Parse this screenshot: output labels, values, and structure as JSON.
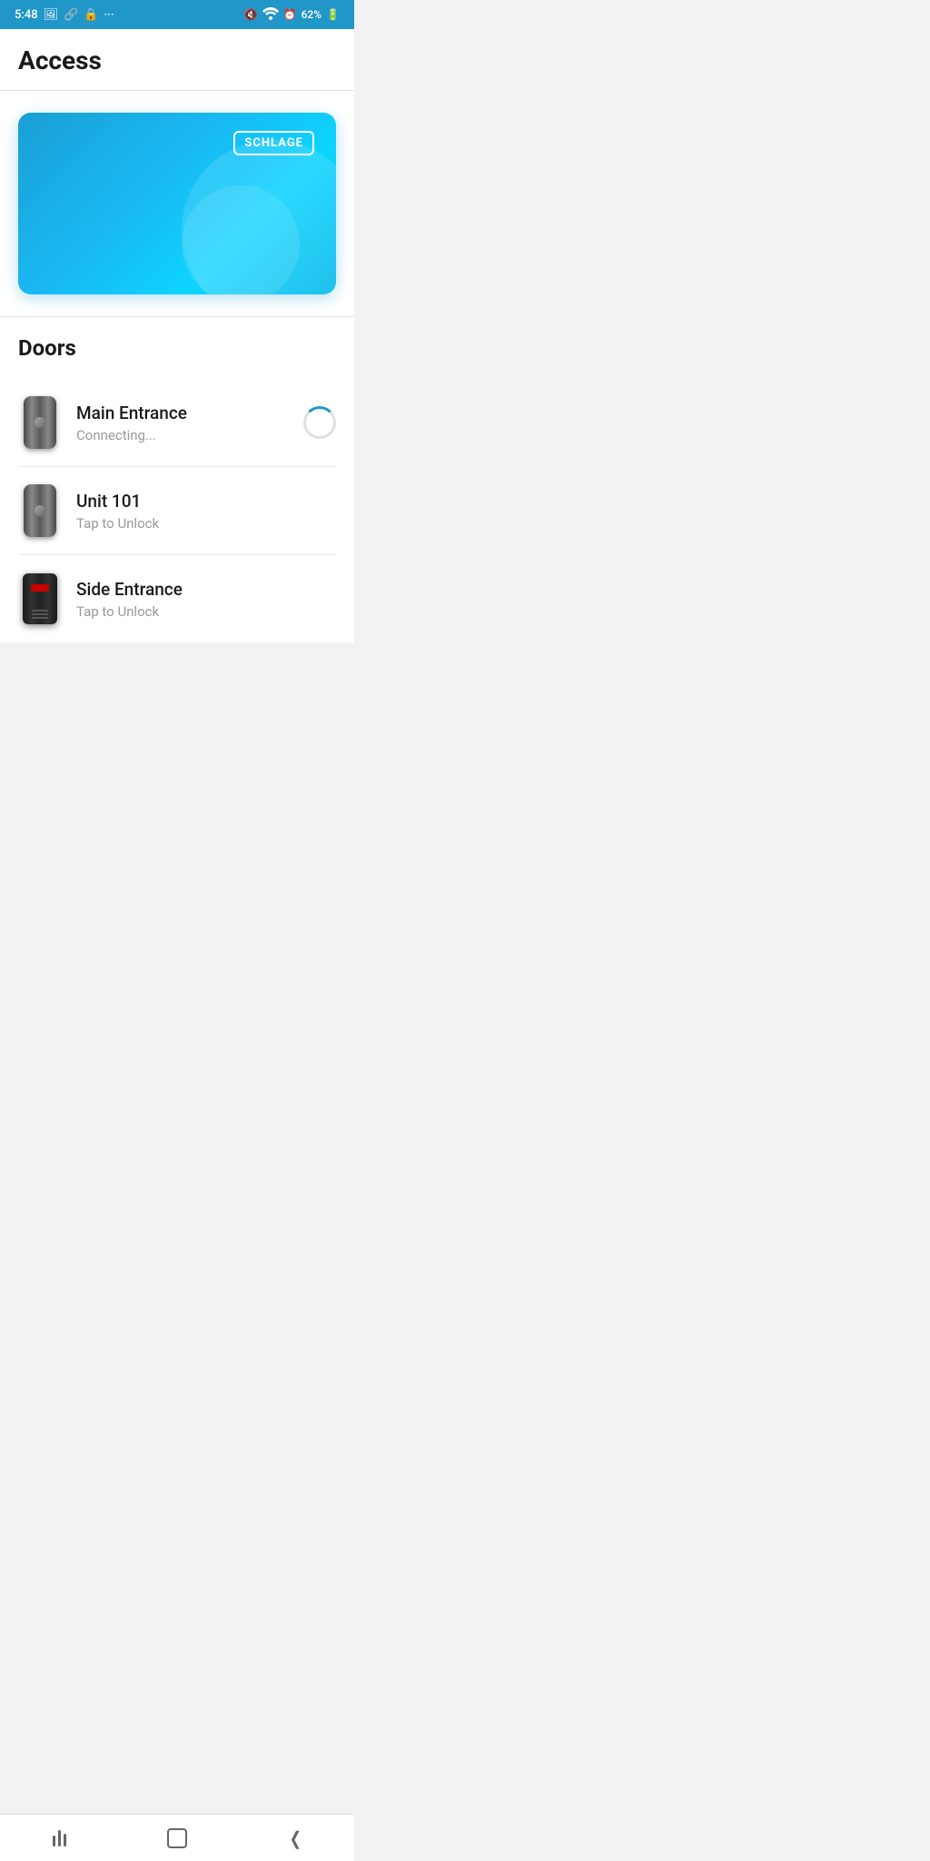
{
  "statusBar": {
    "time": "5:48",
    "battery": "62%",
    "icons": {
      "mute": "🔇",
      "wifi": "wifi",
      "alarm": "⏰",
      "battery": "🔋"
    }
  },
  "header": {
    "title": "Access"
  },
  "card": {
    "brand": "SCHLAGE"
  },
  "doors": {
    "sectionTitle": "Doors",
    "items": [
      {
        "id": "main-entrance",
        "name": "Main Entrance",
        "status": "Connecting...",
        "iconType": "silver",
        "isConnecting": true
      },
      {
        "id": "unit-101",
        "name": "Unit 101",
        "status": "Tap to Unlock",
        "iconType": "silver",
        "isConnecting": false
      },
      {
        "id": "side-entrance",
        "name": "Side Entrance",
        "status": "Tap to Unlock",
        "iconType": "black",
        "isConnecting": false
      }
    ]
  },
  "navBar": {
    "recentsBtnLabel": "Recents",
    "homeBtnLabel": "Home",
    "backBtnLabel": "Back"
  }
}
